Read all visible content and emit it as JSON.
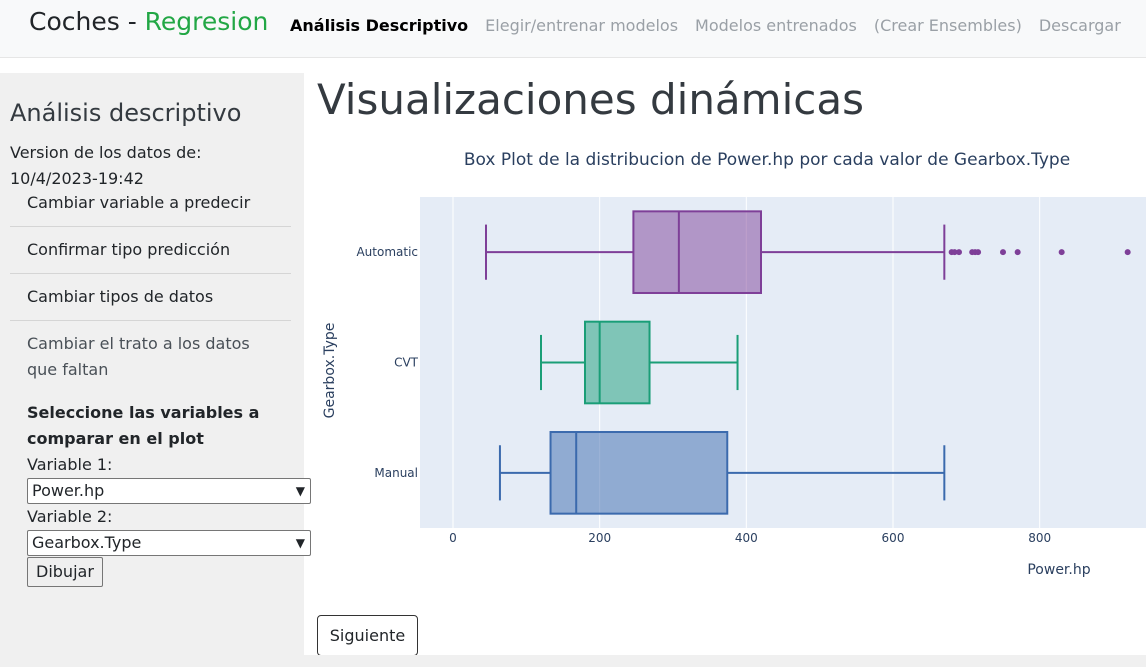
{
  "navbar": {
    "brand_prefix": "Coches - ",
    "brand_highlight": "Regresion",
    "links": [
      "Análisis Descriptivo",
      "Elegir/entrenar modelos",
      "Modelos entrenados",
      "(Crear Ensembles)",
      "Descargar"
    ]
  },
  "sidebar": {
    "title": "Análisis descriptivo",
    "version_label": "Version de los datos de:",
    "version_date": "10/4/2023-19:42",
    "menu": [
      "Cambiar variable a predecir",
      "Confirmar tipo predicción",
      "Cambiar tipos de datos",
      "Cambiar el trato a los datos que faltan"
    ],
    "form_title": "Seleccione las variables a comparar en el plot",
    "var1_label": "Variable 1:",
    "var1_value": "Power.hp",
    "var2_label": "Variable 2:",
    "var2_value": "Gearbox.Type",
    "draw_button": "Dibujar"
  },
  "main": {
    "title": "Visualizaciones dinámicas",
    "next_button": "Siguiente"
  },
  "chart_data": {
    "type": "box",
    "title": "Box Plot de la distribucion de Power.hp por cada valor de Gearbox.Type",
    "xlabel": "Power.hp",
    "ylabel": "Gearbox.Type",
    "xlim": [
      -45,
      945
    ],
    "xticks": [
      0,
      200,
      400,
      600,
      800
    ],
    "grid": true,
    "orientation": "horizontal",
    "series": [
      {
        "name": "Automatic",
        "color": "#7e3f98",
        "min": 45,
        "q1": 246,
        "median": 308,
        "q3": 420,
        "max": 670,
        "outliers": [
          680,
          684,
          690,
          708,
          712,
          716,
          750,
          770,
          830,
          920
        ]
      },
      {
        "name": "CVT",
        "color": "#1a9e77",
        "min": 120,
        "q1": 180,
        "median": 200,
        "q3": 268,
        "max": 388,
        "outliers": []
      },
      {
        "name": "Manual",
        "color": "#3b6aad",
        "min": 64,
        "q1": 133,
        "median": 168,
        "q3": 374,
        "max": 670,
        "outliers": []
      }
    ]
  }
}
